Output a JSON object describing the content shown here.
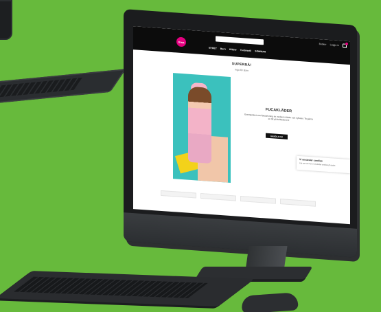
{
  "header": {
    "logo_text": "Gina",
    "search_placeholder": "",
    "utility_links": [
      "Butiker",
      "Logga in"
    ],
    "nav": [
      "NYHET",
      "Barn",
      "Kläder",
      "Tonårsstil",
      "SOMMAR"
    ]
  },
  "hero": {
    "heading": "SUPERRÅ!",
    "subheading": "Inga för Barn",
    "promo_title": "FUCAKLÄDER",
    "promo_text": "Exempeltext med beskrivning av veckans kläder och nyheter. Ta gärna en titt på kollektionen!",
    "shop_button": "HANDLA NU"
  },
  "toast": {
    "title": "Vi använder cookies",
    "text": "Läs mer om hur vi använder cookies på sidan"
  },
  "colors": {
    "accent": "#e4007f",
    "background": "#67ba3c",
    "header": "#0c0c0c"
  }
}
